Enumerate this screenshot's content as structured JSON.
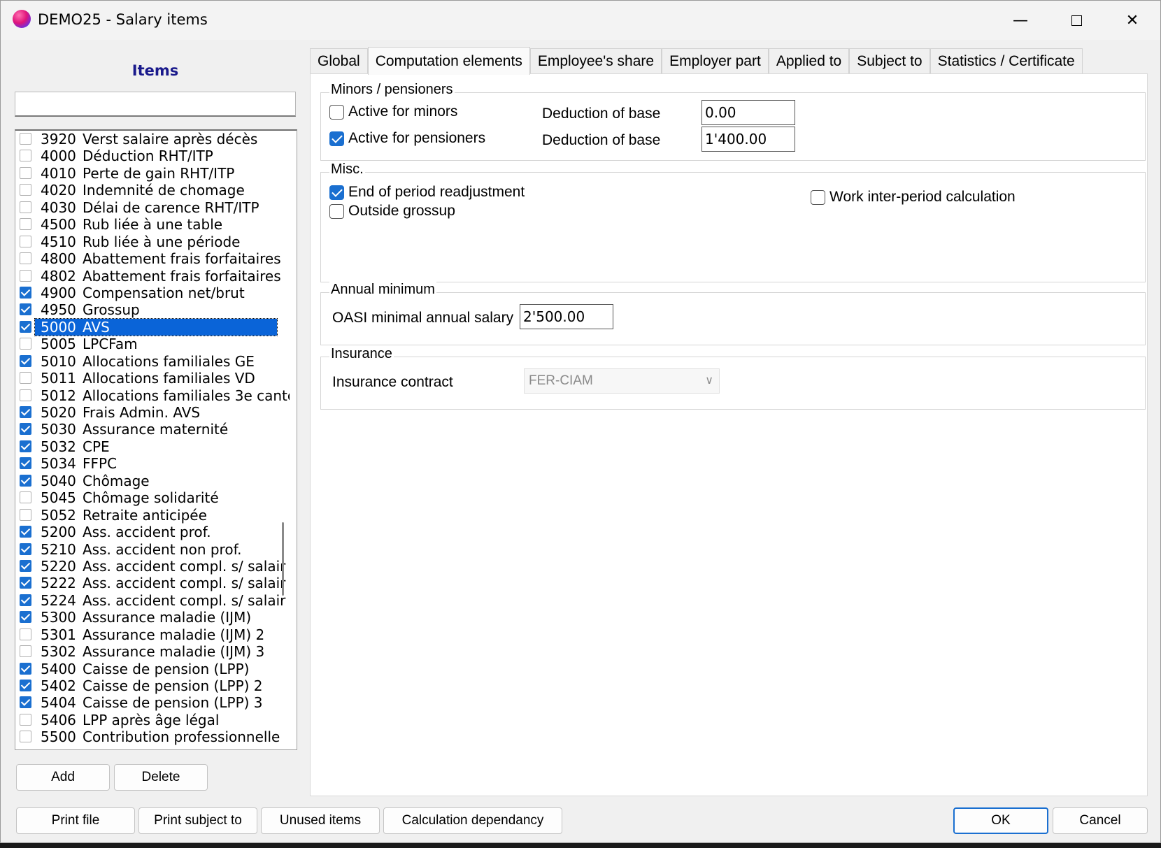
{
  "window": {
    "title": "DEMO25 - Salary items"
  },
  "items_panel": {
    "title": "Items",
    "search_value": ""
  },
  "items": [
    {
      "code": "3920",
      "label": "Verst salaire après décès",
      "checked": false
    },
    {
      "code": "4000",
      "label": "Déduction RHT/ITP",
      "checked": false
    },
    {
      "code": "4010",
      "label": "Perte de gain RHT/ITP",
      "checked": false
    },
    {
      "code": "4020",
      "label": "Indemnité de chomage",
      "checked": false
    },
    {
      "code": "4030",
      "label": "Délai de carence RHT/ITP",
      "checked": false
    },
    {
      "code": "4500",
      "label": "Rub liée à une table",
      "checked": false
    },
    {
      "code": "4510",
      "label": "Rub liée à une période",
      "checked": false
    },
    {
      "code": "4800",
      "label": "Abattement frais forfaitaires",
      "checked": false
    },
    {
      "code": "4802",
      "label": "Abattement frais forfaitaires",
      "checked": false
    },
    {
      "code": "4900",
      "label": "Compensation net/brut",
      "checked": true
    },
    {
      "code": "4950",
      "label": "Grossup",
      "checked": true
    },
    {
      "code": "5000",
      "label": "AVS",
      "checked": true,
      "selected": true
    },
    {
      "code": "5005",
      "label": "LPCFam",
      "checked": false
    },
    {
      "code": "5010",
      "label": "Allocations familiales GE",
      "checked": true
    },
    {
      "code": "5011",
      "label": "Allocations familiales VD",
      "checked": false
    },
    {
      "code": "5012",
      "label": "Allocations familiales 3e canto",
      "checked": false
    },
    {
      "code": "5020",
      "label": "Frais Admin. AVS",
      "checked": true
    },
    {
      "code": "5030",
      "label": "Assurance maternité",
      "checked": true
    },
    {
      "code": "5032",
      "label": "CPE",
      "checked": true
    },
    {
      "code": "5034",
      "label": "FFPC",
      "checked": true
    },
    {
      "code": "5040",
      "label": "Chômage",
      "checked": true
    },
    {
      "code": "5045",
      "label": "Chômage solidarité",
      "checked": false
    },
    {
      "code": "5052",
      "label": "Retraite anticipée",
      "checked": false
    },
    {
      "code": "5200",
      "label": "Ass. accident prof.",
      "checked": true
    },
    {
      "code": "5210",
      "label": "Ass. accident non prof.",
      "checked": true
    },
    {
      "code": "5220",
      "label": "Ass. accident compl. s/ salair",
      "checked": true
    },
    {
      "code": "5222",
      "label": "Ass. accident compl. s/ salair",
      "checked": true
    },
    {
      "code": "5224",
      "label": "Ass. accident compl. s/ salair",
      "checked": true
    },
    {
      "code": "5300",
      "label": "Assurance maladie (IJM)",
      "checked": true
    },
    {
      "code": "5301",
      "label": "Assurance maladie (IJM) 2",
      "checked": false
    },
    {
      "code": "5302",
      "label": "Assurance maladie (IJM) 3",
      "checked": false
    },
    {
      "code": "5400",
      "label": "Caisse de pension (LPP)",
      "checked": true
    },
    {
      "code": "5402",
      "label": "Caisse de pension (LPP) 2",
      "checked": true
    },
    {
      "code": "5404",
      "label": "Caisse de pension (LPP) 3",
      "checked": true
    },
    {
      "code": "5406",
      "label": "LPP après âge légal",
      "checked": false
    },
    {
      "code": "5500",
      "label": "Contribution professionnelle",
      "checked": false
    }
  ],
  "buttons": {
    "add": "Add",
    "delete": "Delete",
    "print_file": "Print file",
    "print_subject": "Print subject to",
    "unused": "Unused items",
    "calc_dep": "Calculation dependancy",
    "ok": "OK",
    "cancel": "Cancel"
  },
  "tabs": [
    {
      "label": "Global",
      "active": false
    },
    {
      "label": "Computation elements",
      "active": true
    },
    {
      "label": "Employee's share",
      "active": false
    },
    {
      "label": "Employer part",
      "active": false
    },
    {
      "label": "Applied to",
      "active": false
    },
    {
      "label": "Subject to",
      "active": false
    },
    {
      "label": "Statistics / Certificate",
      "active": false
    }
  ],
  "minors": {
    "title": "Minors / pensioners",
    "active_minors": {
      "label": "Active for minors",
      "checked": false
    },
    "active_pensioners": {
      "label": "Active for pensioners",
      "checked": true
    },
    "deduction_label": "Deduction of base",
    "deduction_minors": "0.00",
    "deduction_pensioners": "1'400.00"
  },
  "misc": {
    "title": "Misc.",
    "end_period": {
      "label": "End of period readjustment",
      "checked": true
    },
    "outside_grossup": {
      "label": "Outside grossup",
      "checked": false
    },
    "work_inter": {
      "label": "Work inter-period calculation",
      "checked": false
    }
  },
  "annual": {
    "title": "Annual minimum",
    "oasi_label": "OASI minimal annual salary",
    "oasi_value": "2'500.00"
  },
  "insurance": {
    "title": "Insurance",
    "contract_label": "Insurance contract",
    "contract_value": "FER-CIAM"
  },
  "icons": {
    "minimize": "minimize-icon",
    "maximize": "maximize-icon",
    "close": "close-icon",
    "dropdown": "chevron-down-icon"
  },
  "colors": {
    "accent": "#1a6fd0",
    "selection": "#0a64d8",
    "items_title": "#1a1a8c"
  }
}
